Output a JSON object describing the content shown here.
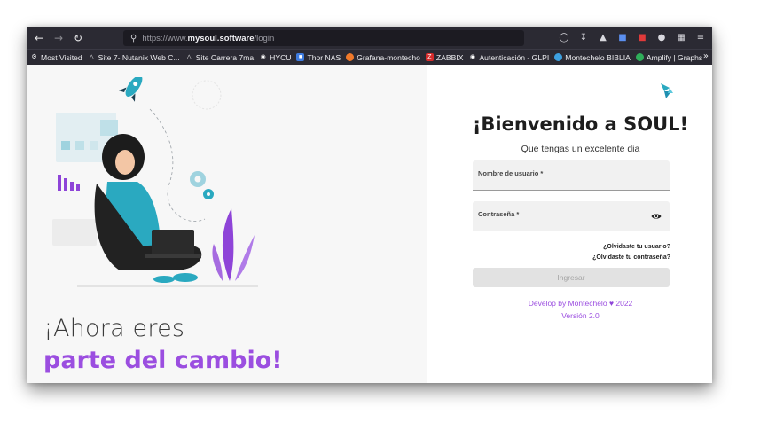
{
  "browser": {
    "url_prefix": "https://www.",
    "url_domain": "mysoul.software",
    "url_path": "/login",
    "bookmarks": [
      {
        "label": "Most Visited",
        "icon": "gear-icon",
        "color": "#ededf0"
      },
      {
        "label": "Site 7- Nutanix Web C...",
        "icon": "nutanix-icon",
        "color": "#ffffff"
      },
      {
        "label": "Site Carrera 7ma",
        "icon": "nutanix-icon",
        "color": "#ffffff"
      },
      {
        "label": "HYCU",
        "icon": "globe-icon",
        "color": "#ededf0"
      },
      {
        "label": "Thor NAS",
        "icon": "nas-icon",
        "color": "#3d7be0"
      },
      {
        "label": "Grafana-montecho",
        "icon": "grafana-icon",
        "color": "#f0792a"
      },
      {
        "label": "ZABBIX",
        "icon": "zabbix-icon",
        "color": "#d62c2c"
      },
      {
        "label": "Autenticación - GLPI",
        "icon": "globe-icon",
        "color": "#ededf0"
      },
      {
        "label": "Montechelo BIBLIA",
        "icon": "bible-icon",
        "color": "#3da0e0"
      },
      {
        "label": "Amplify | Graphs",
        "icon": "amplify-icon",
        "color": "#2fae5a"
      }
    ],
    "more_glyph": "»"
  },
  "hero": {
    "line1": "¡Ahora eres",
    "line2": "parte del cambio!"
  },
  "login": {
    "title": "¡Bienvenido a SOUL!",
    "subtitle": "Que tengas un excelente dia",
    "username_label": "Nombre de usuario *",
    "password_label": "Contraseña *",
    "forgot_user": "¿Olvidaste tu usuario?",
    "forgot_password": "¿Olvidaste tu contraseña?",
    "submit_label": "Ingresar",
    "credit_prefix": "Develop by Montechelo",
    "credit_year": "2022",
    "version": "Versión 2.0"
  },
  "colors": {
    "accent": "#9b4ee0",
    "teal": "#2aa9c0",
    "toolbar": "#2b2a33"
  }
}
